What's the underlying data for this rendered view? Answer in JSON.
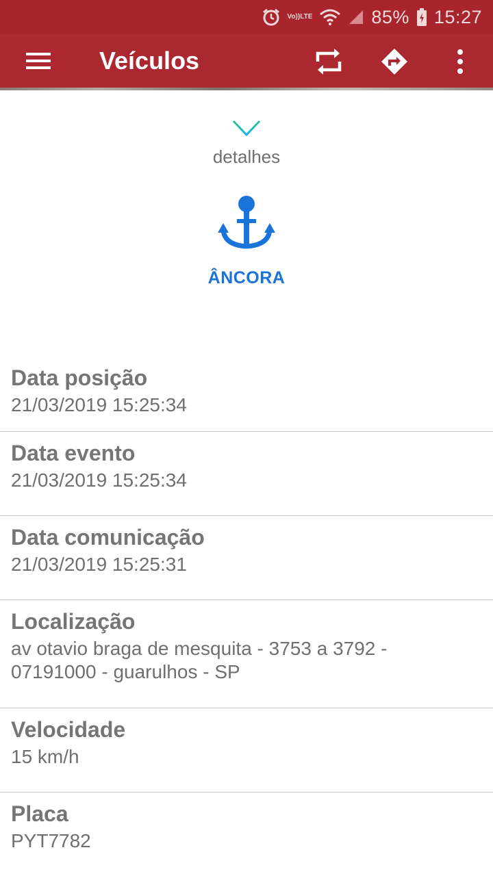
{
  "status_bar": {
    "icons": [
      "alarm-icon",
      "volte-icon",
      "wifi-icon",
      "signal-icon",
      "battery-charging-icon"
    ],
    "volte_top": "Vo))",
    "volte_bottom": "LTE",
    "battery": "85%",
    "time": "15:27"
  },
  "app_bar": {
    "title": "Veículos",
    "menu_icon": "hamburger-menu-icon",
    "actions": [
      "sync-icon",
      "directions-icon",
      "more-vert-icon"
    ],
    "color": "#ab2830"
  },
  "details_toggle": {
    "icon": "arrow-down-icon",
    "label": "detalhes"
  },
  "anchor": {
    "icon": "anchor-icon",
    "label": "ÂNCORA",
    "color": "#1a73d9"
  },
  "info": {
    "data_posicao": {
      "label": "Data posição",
      "value": "21/03/2019 15:25:34"
    },
    "data_evento": {
      "label": "Data evento",
      "value": "21/03/2019 15:25:34"
    },
    "data_comunicacao": {
      "label": "Data comunicação",
      "value": "21/03/2019 15:25:31"
    },
    "localizacao": {
      "label": "Localização",
      "value_line1": "av otavio braga de mesquita - 3753 a 3792 -",
      "value_line2": "07191000 - guarulhos - SP"
    },
    "velocidade": {
      "label": "Velocidade",
      "value": "15 km/h"
    },
    "placa": {
      "label": "Placa",
      "value": "PYT7782"
    }
  }
}
